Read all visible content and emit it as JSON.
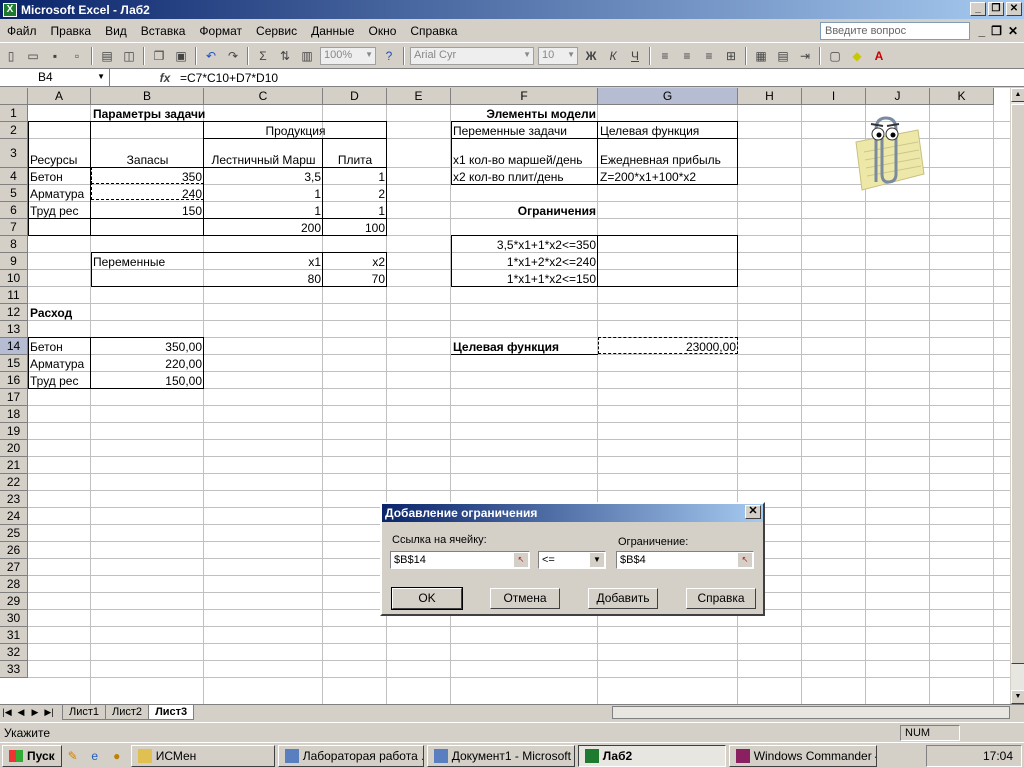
{
  "window": {
    "app_title": "Microsoft Excel - Лаб2",
    "help_placeholder": "Введите вопрос"
  },
  "menu": [
    "Файл",
    "Правка",
    "Вид",
    "Вставка",
    "Формат",
    "Сервис",
    "Данные",
    "Окно",
    "Справка"
  ],
  "toolbar": {
    "zoom": "100%",
    "font": "Arial Cyr",
    "size": "10",
    "bold": "Ж",
    "italic": "К",
    "underline": "Ч"
  },
  "formula_bar": {
    "name_box": "B4",
    "fx": "fx",
    "formula": "=C7*C10+D7*D10"
  },
  "columns": [
    "A",
    "B",
    "C",
    "D",
    "E",
    "F",
    "G",
    "H",
    "I",
    "J",
    "K"
  ],
  "rows": [
    "1",
    "2",
    "3",
    "4",
    "5",
    "6",
    "7",
    "8",
    "9",
    "10",
    "11",
    "12",
    "13",
    "14",
    "15",
    "16",
    "17",
    "18",
    "19",
    "20",
    "21",
    "22",
    "23",
    "24",
    "25",
    "26",
    "27",
    "28",
    "29",
    "30",
    "31",
    "32",
    "33"
  ],
  "cells": {
    "B1": "Параметры задачи",
    "F1": "Элементы модели",
    "C2": "Продукция",
    "F2": "Переменные задачи",
    "G2": "Целевая функция",
    "A3": "Ресурсы",
    "B3": "Запасы",
    "C3": "Лестничный Марш",
    "D3": "Плита",
    "F3": "x1 кол-во маршей/день",
    "G3": "Ежедневная прибыль",
    "A4": "Бетон",
    "B4": "350",
    "C4": "3,5",
    "D4": "1",
    "F4": "x2 кол-во плит/день",
    "G4": "Z=200*x1+100*x2",
    "A5": "Арматура",
    "B5": "240",
    "C5": "1",
    "D5": "2",
    "A6": "Труд рес",
    "B6": "150",
    "C6": "1",
    "D6": "1",
    "F6": "Ограничения",
    "C7": "200",
    "D7": "100",
    "F8": "3,5*x1+1*x2<=350",
    "B9": "Переменные",
    "C9": "x1",
    "D9": "x2",
    "F9": "1*x1+2*x2<=240",
    "C10": "80",
    "D10": "70",
    "F10": "1*x1+1*x2<=150",
    "A12": "Расход",
    "A14": "Бетон",
    "B14": "350,00",
    "F14": "Целевая функция",
    "G14": "23000,00",
    "A15": "Арматура",
    "B15": "220,00",
    "A16": "Труд рес",
    "B16": "150,00"
  },
  "sheets": [
    "Лист1",
    "Лист2",
    "Лист3"
  ],
  "active_sheet": "Лист3",
  "status": {
    "text": "Укажите",
    "num": "NUM"
  },
  "dialog": {
    "title": "Добавление ограничения",
    "cell_ref_label": "Ссылка на ячейку:",
    "cell_ref_value": "$B$14",
    "operator": "<=",
    "constraint_label": "Ограничение:",
    "constraint_value": "$B$4",
    "ok": "OK",
    "cancel": "Отмена",
    "add": "Добавить",
    "help": "Справка"
  },
  "taskbar": {
    "start": "Пуск",
    "tasks": [
      "ИСМен",
      "Лабораторая работа ...",
      "Документ1 - Microsoft ...",
      "Лаб2",
      "Windows Commander 4..."
    ],
    "clock": "17:04"
  }
}
